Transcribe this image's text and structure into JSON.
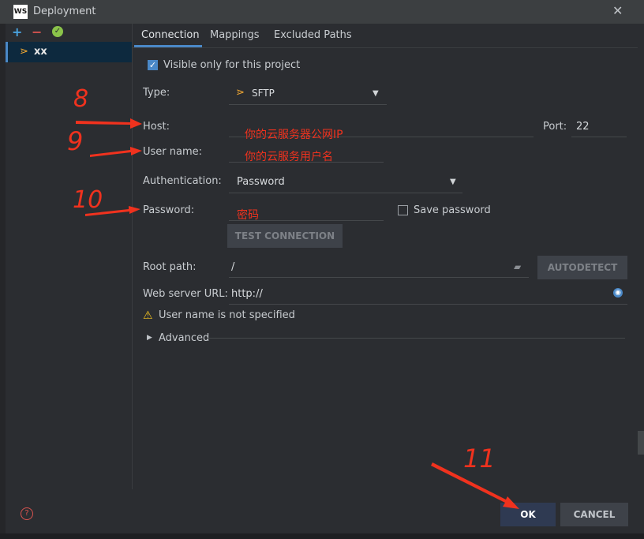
{
  "window": {
    "title": "Deployment",
    "app_icon_text": "WS"
  },
  "left": {
    "servers": [
      {
        "name": "xx"
      }
    ]
  },
  "tabs": [
    {
      "label": "Connection"
    },
    {
      "label": "Mappings"
    },
    {
      "label": "Excluded Paths"
    }
  ],
  "form": {
    "visible_only": "Visible only for this project",
    "type_label": "Type:",
    "type_value": "SFTP",
    "host_label": "Host:",
    "port_label": "Port:",
    "port_value": "22",
    "username_label": "User name:",
    "auth_label": "Authentication:",
    "auth_value": "Password",
    "password_label": "Password:",
    "save_password": "Save password",
    "test_connection": "TEST CONNECTION",
    "root_path_label": "Root path:",
    "root_path_value": "/",
    "autodetect": "AUTODETECT",
    "web_url_label": "Web server URL:",
    "web_url_value": "http://",
    "warning": "User name is not specified",
    "advanced": "Advanced"
  },
  "annotations": {
    "host_note": "你的云服务器公网IP",
    "user_note": "你的云服务用户名",
    "password_note": "密码",
    "step_8": "8",
    "step_9": "9",
    "step_10": "10",
    "step_11": "11"
  },
  "footer": {
    "ok": "OK",
    "cancel": "CANCEL",
    "help": "?"
  }
}
